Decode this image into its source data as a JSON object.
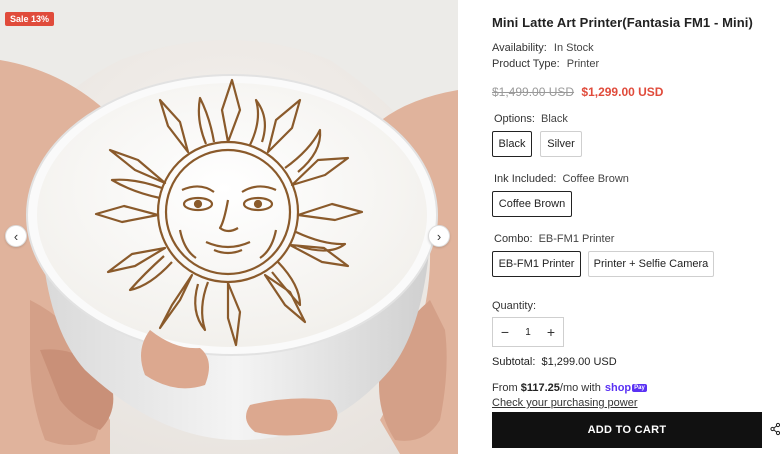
{
  "gallery": {
    "sale_badge": "Sale 13%",
    "prev_icon": "chevron-left-icon",
    "next_icon": "chevron-right-icon"
  },
  "product": {
    "title": "Mini Latte Art Printer(Fantasia FM1 - Mini)",
    "availability_label": "Availability:",
    "availability_value": "In Stock",
    "type_label": "Product Type:",
    "type_value": "Printer",
    "old_price": "$1,499.00 USD",
    "price": "$1,299.00 USD"
  },
  "options": [
    {
      "label": "Options:",
      "selected": "Black",
      "values": [
        "Black",
        "Silver"
      ]
    },
    {
      "label": "Ink Included:",
      "selected": "Coffee Brown",
      "values": [
        "Coffee Brown"
      ]
    },
    {
      "label": "Combo:",
      "selected": "EB-FM1 Printer",
      "values": [
        "EB-FM1 Printer",
        "Printer + Selfie Camera"
      ]
    }
  ],
  "quantity": {
    "label": "Quantity:",
    "value": "1",
    "minus": "−",
    "plus": "+"
  },
  "subtotal": {
    "label": "Subtotal:",
    "value": "$1,299.00 USD"
  },
  "finance": {
    "prefix": "From",
    "amount": "$117.25",
    "suffix": "/mo with",
    "brand": "shop",
    "brand_badge": "Pay",
    "link": "Check your purchasing power"
  },
  "cart": {
    "label": "ADD TO CART"
  },
  "colors": {
    "sale": "#e04b3b",
    "price": "#e04b3b",
    "button": "#111111",
    "shoppay": "#5a31f4"
  },
  "icons": {
    "share": "share-icon"
  }
}
